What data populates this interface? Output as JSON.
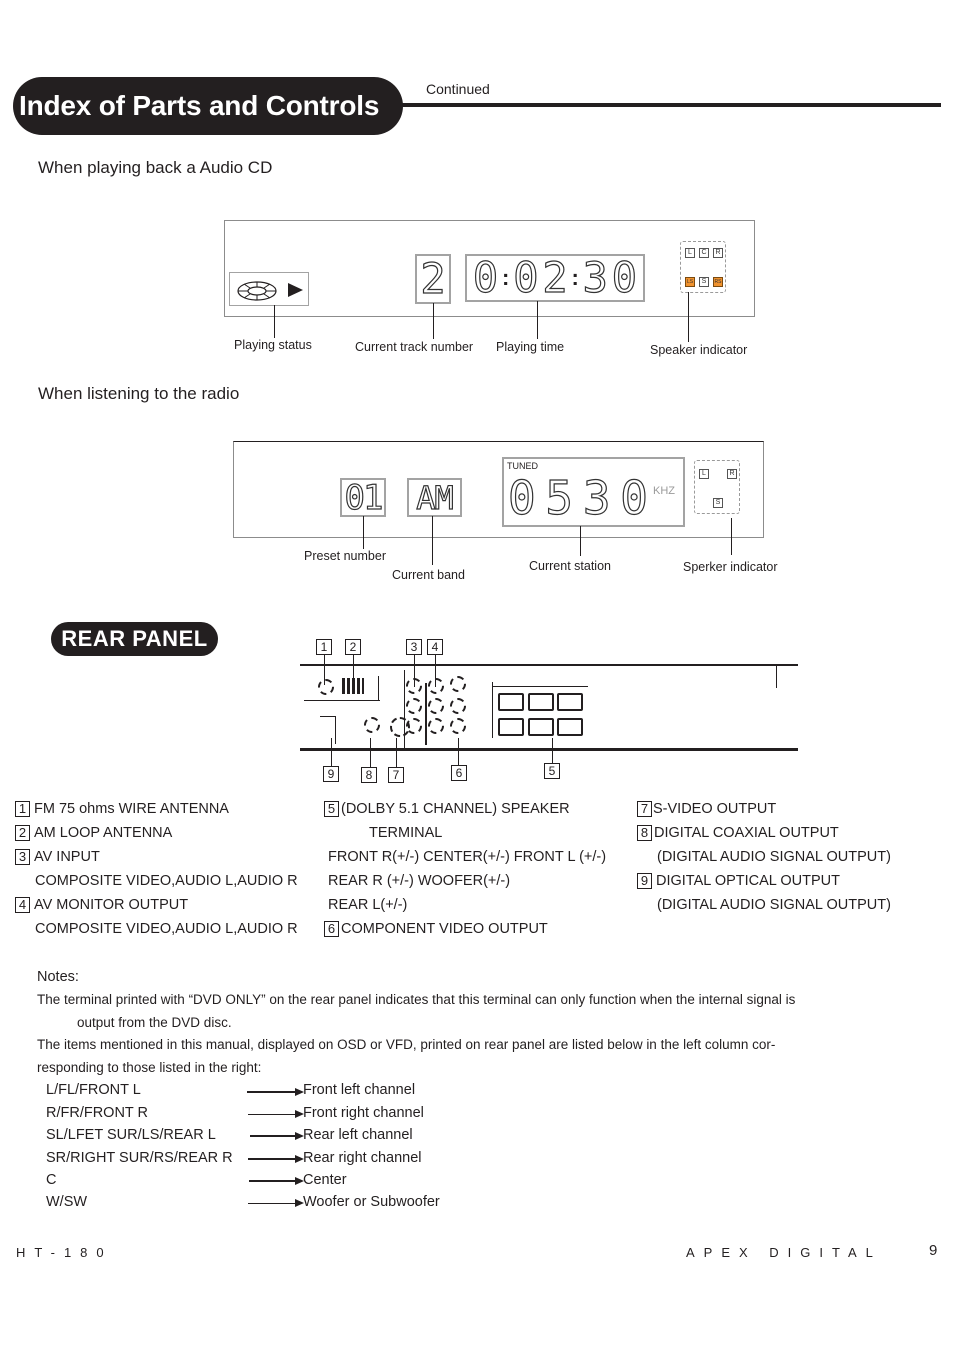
{
  "header": {
    "title": "Index of Parts and Controls",
    "continued": "Continued"
  },
  "cd_section": {
    "heading": "When playing back a Audio CD",
    "display": {
      "track_number": "2",
      "playing_time": [
        "0",
        ":",
        "0",
        "2",
        ":",
        "3",
        "0"
      ],
      "speakers_top": [
        "L",
        "C",
        "R"
      ],
      "speakers_bottom": [
        "LS",
        "S",
        "RS"
      ],
      "speakers_active": [
        "LS",
        "RS"
      ],
      "active_color": "#f0922e"
    },
    "labels": {
      "playing_status": "Playing status",
      "current_track": "Current track number",
      "playing_time": "Playing time",
      "speaker_indicator": "Speaker indicator"
    }
  },
  "radio_section": {
    "heading": "When listening to the radio",
    "display": {
      "preset_number": "01",
      "band": "AM",
      "tuned_label": "TUNED",
      "station_digits": [
        "0",
        "5",
        "3",
        "0"
      ],
      "unit": "KHZ",
      "speakers_top": [
        "L",
        "R"
      ],
      "speakers_bottom": [
        "S"
      ]
    },
    "labels": {
      "preset_number": "Preset number",
      "current_band": "Current band",
      "current_station": "Current station",
      "speaker_indicator": "Sperker indicator"
    }
  },
  "rear_panel": {
    "title": "REAR  PANEL",
    "callouts_top": [
      "1",
      "2",
      "3",
      "4"
    ],
    "callouts_bottom": [
      "9",
      "8",
      "7",
      "6",
      "5"
    ]
  },
  "legend": {
    "col1": [
      {
        "num": "1",
        "text": "FM 75 ohms WIRE ANTENNA"
      },
      {
        "num": "2",
        "text": "AM LOOP ANTENNA"
      },
      {
        "num": "3",
        "text": "AV INPUT"
      },
      {
        "num": "",
        "text": "COMPOSITE VIDEO,AUDIO L,AUDIO R"
      },
      {
        "num": "4",
        "text": "AV MONITOR OUTPUT"
      },
      {
        "num": "",
        "text": "COMPOSITE VIDEO,AUDIO L,AUDIO R"
      }
    ],
    "col2": [
      {
        "num": "5",
        "text": "(DOLBY 5.1 CHANNEL) SPEAKER"
      },
      {
        "num": "",
        "text": "TERMINAL"
      },
      {
        "num": "",
        "text": "FRONT R(+/-)  CENTER(+/-)  FRONT L (+/-)"
      },
      {
        "num": "",
        "text": "REAR R (+/-)  WOOFER(+/-)"
      },
      {
        "num": "",
        "text": "REAR L(+/-)"
      },
      {
        "num": "6",
        "text": "COMPONENT VIDEO OUTPUT"
      }
    ],
    "col3": [
      {
        "num": "7",
        "text": "S-VIDEO OUTPUT"
      },
      {
        "num": "8",
        "text": "DIGITAL COAXIAL OUTPUT"
      },
      {
        "num": "",
        "text": "(DIGITAL AUDIO SIGNAL OUTPUT)"
      },
      {
        "num": "9",
        "text": "DIGITAL OPTICAL OUTPUT"
      },
      {
        "num": "",
        "text": "(DIGITAL AUDIO SIGNAL OUTPUT)"
      }
    ]
  },
  "notes": {
    "heading": "Notes:",
    "lines": [
      "The terminal printed with “DVD ONLY” on the rear panel indicates that this terminal can only function when the internal signal is",
      "output from the DVD disc.",
      " The items mentioned in this manual, displayed on OSD or VFD, printed on rear panel are listed below in the left column cor-",
      "responding to those listed in the right:"
    ],
    "mapping": [
      {
        "from": "L/FL/FRONT L",
        "to": "Front left channel"
      },
      {
        "from": "R/FR/FRONT R",
        "to": "Front right channel"
      },
      {
        "from": "SL/LFET SUR/LS/REAR L",
        "to": "Rear left channel"
      },
      {
        "from": "SR/RIGHT SUR/RS/REAR R",
        "to": "Rear right channel"
      },
      {
        "from": "C",
        "to": "Center"
      },
      {
        "from": "W/SW",
        "to": "Woofer or Subwoofer"
      }
    ]
  },
  "footer": {
    "model": "HT-180",
    "brand": "APEX DIGITAL",
    "page": "9"
  }
}
